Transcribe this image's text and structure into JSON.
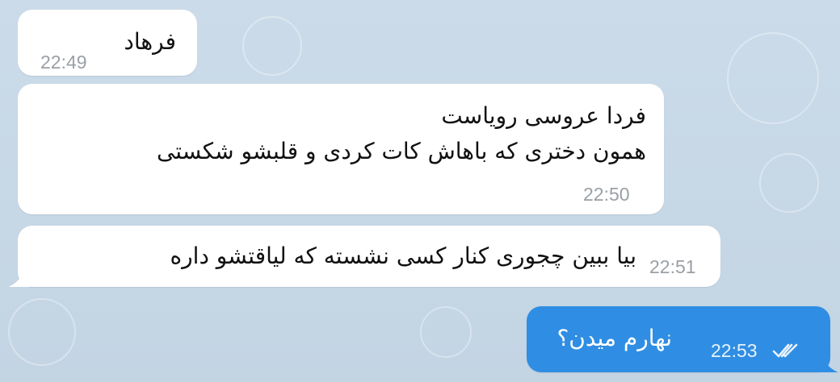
{
  "messages": [
    {
      "direction": "incoming",
      "text": "فرهاد",
      "time": "22:49"
    },
    {
      "direction": "incoming",
      "text": "فردا عروسی رویاست\nهمون دختری که باهاش کات کردی و قلبشو شکستی",
      "time": "22:50"
    },
    {
      "direction": "incoming",
      "text": "بیا ببین چجوری کنار کسی نشسته که لیاقتشو داره",
      "time": "22:51"
    },
    {
      "direction": "outgoing",
      "text": "نهارم میدن؟",
      "time": "22:53",
      "status_icon": "double-check-icon"
    }
  ],
  "colors": {
    "background": "#c8d8e6",
    "incoming_bubble": "#ffffff",
    "outgoing_bubble": "#2f8ee3",
    "time_incoming": "#9aa0a6",
    "time_outgoing": "#e8f2fc"
  }
}
